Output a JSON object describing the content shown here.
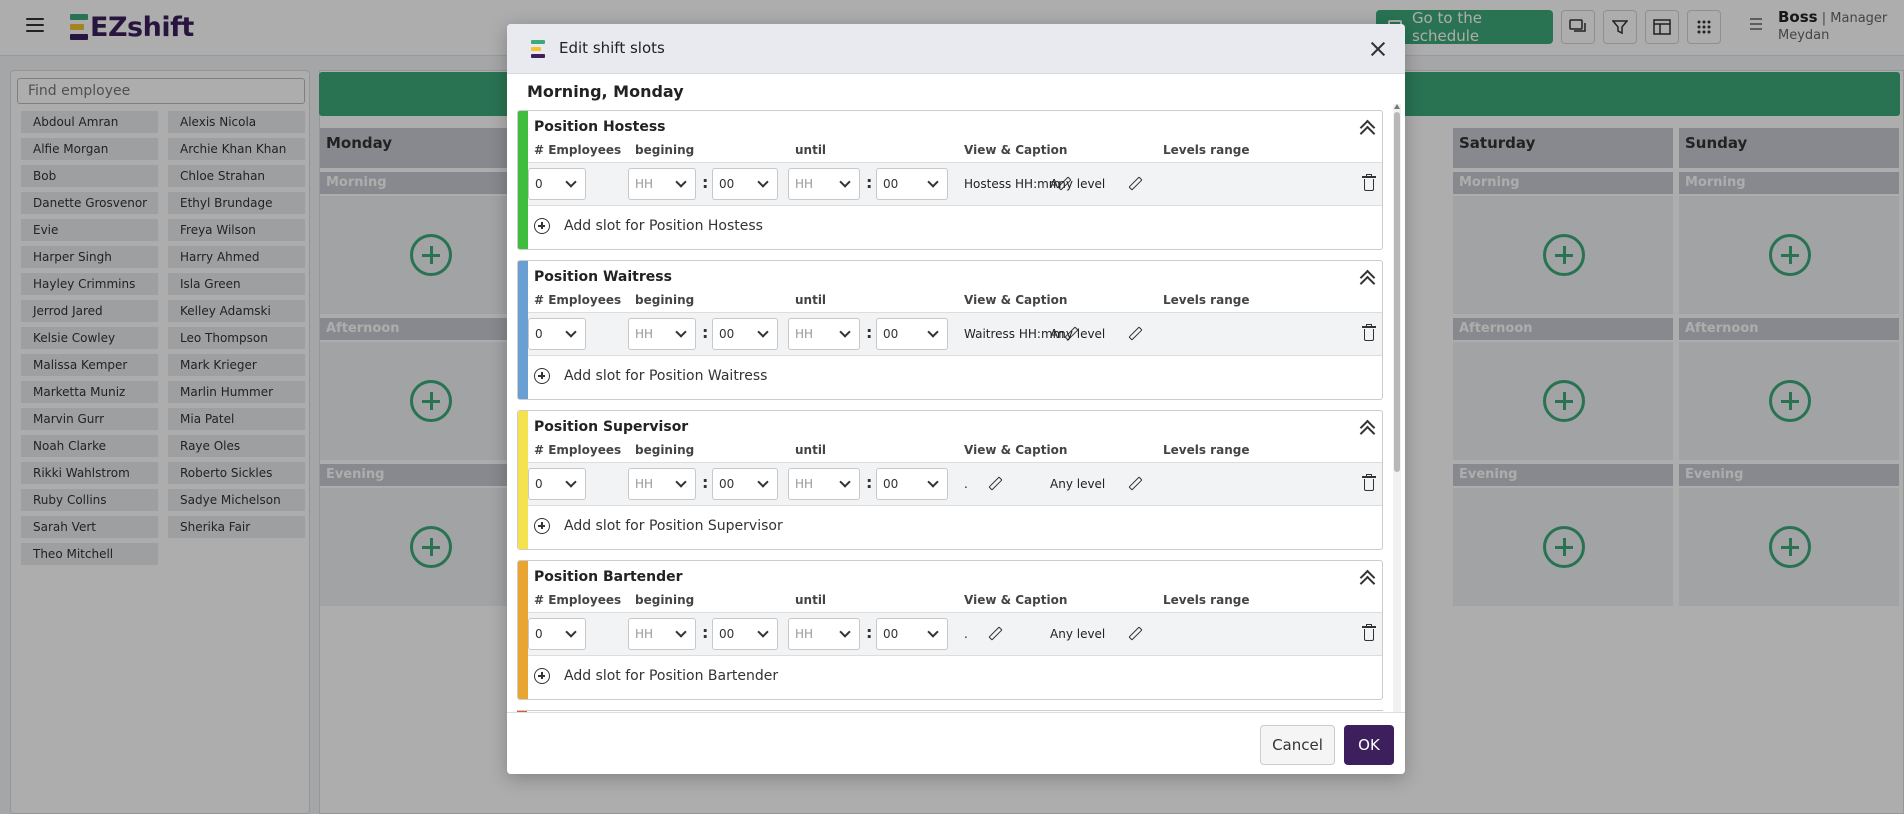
{
  "header": {
    "logo_text": "EZshift",
    "goto_label": "Go to the schedule",
    "user_name": "Boss",
    "user_separator": " | ",
    "user_role": "Manager",
    "user_location": "Meydan",
    "brand_color": "#3c1f5c",
    "accent_color": "#3daa7b"
  },
  "employees": {
    "search_placeholder": "Find employee",
    "list": [
      "Abdoul Amran",
      "Alexis Nicola",
      "Alfie Morgan",
      "Archie Khan Khan",
      "Bob",
      "Chloe Strahan",
      "Danette Grosvenor",
      "Ethyl Brundage",
      "Evie",
      "Freya Wilson",
      "Harper Singh",
      "Harry Ahmed",
      "Hayley Crimmins",
      "Isla Green",
      "Jerrod Jared",
      "Kelley Adamski",
      "Kelsie Cowley",
      "Leo Thompson",
      "Malissa Kemper",
      "Mark Krieger",
      "Marketta Muniz",
      "Marlin Hummer",
      "Marvin Gurr",
      "Mia Patel",
      "Noah Clarke",
      "Raye Oles",
      "Rikki Wahlstrom",
      "Roberto Sickles",
      "Ruby Collins",
      "Sadye Michelson",
      "Sarah Vert",
      "Sherika Fair",
      "Theo Mitchell"
    ]
  },
  "schedule": {
    "days": [
      "Monday",
      "Saturday",
      "Sunday"
    ],
    "periods": [
      "Morning",
      "Afternoon",
      "Evening"
    ]
  },
  "modal": {
    "title": "Edit shift slots",
    "subtitle": "Morning, Monday",
    "columns": {
      "employees": "# Employees",
      "beginning": "begining",
      "until": "until",
      "caption": "View & Caption",
      "levels": "Levels range"
    },
    "positions": [
      {
        "name": "Position Hostess",
        "color": "#3fbd3f",
        "employees": "0",
        "begin_h": "HH",
        "begin_m": "00",
        "until_h": "HH",
        "until_m": "00",
        "caption": "Hostess HH:mm",
        "levels": "Any level",
        "add_label": "Add slot for Position Hostess"
      },
      {
        "name": "Position Waitress",
        "color": "#6a9fd4",
        "employees": "0",
        "begin_h": "HH",
        "begin_m": "00",
        "until_h": "HH",
        "until_m": "00",
        "caption": "Waitress HH:mm",
        "levels": "Any level",
        "add_label": "Add slot for Position Waitress"
      },
      {
        "name": "Position Supervisor",
        "color": "#f5e24f",
        "employees": "0",
        "begin_h": "HH",
        "begin_m": "00",
        "until_h": "HH",
        "until_m": "00",
        "caption": ".",
        "levels": "Any level",
        "add_label": "Add slot for Position Supervisor"
      },
      {
        "name": "Position Bartender",
        "color": "#e8a531",
        "employees": "0",
        "begin_h": "HH",
        "begin_m": "00",
        "until_h": "HH",
        "until_m": "00",
        "caption": ".",
        "levels": "Any level",
        "add_label": "Add slot for Position Bartender"
      }
    ],
    "colon": ":",
    "cancel_label": "Cancel",
    "ok_label": "OK"
  }
}
